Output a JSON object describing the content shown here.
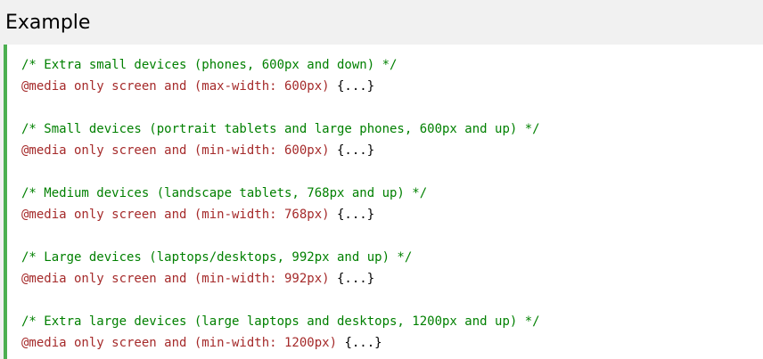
{
  "header": {
    "title": "Example"
  },
  "code": {
    "blocks": [
      {
        "comment": "/* Extra small devices (phones, 600px and down) */",
        "rule": "@media only screen and (max-width: 600px)",
        "braces": " {...}"
      },
      {
        "comment": "/* Small devices (portrait tablets and large phones, 600px and up) */",
        "rule": "@media only screen and (min-width: 600px)",
        "braces": " {...}"
      },
      {
        "comment": "/* Medium devices (landscape tablets, 768px and up) */",
        "rule": "@media only screen and (min-width: 768px)",
        "braces": " {...}"
      },
      {
        "comment": "/* Large devices (laptops/desktops, 992px and up) */",
        "rule": "@media only screen and (min-width: 992px)",
        "braces": " {...}"
      },
      {
        "comment": "/* Extra large devices (large laptops and desktops, 1200px and up) */",
        "rule": "@media only screen and (min-width: 1200px)",
        "braces": " {...}"
      }
    ]
  },
  "colors": {
    "accent_border": "#4caf50",
    "comment": "#008000",
    "rule": "#a52a2a",
    "panel_background": "#f1f1f1"
  }
}
